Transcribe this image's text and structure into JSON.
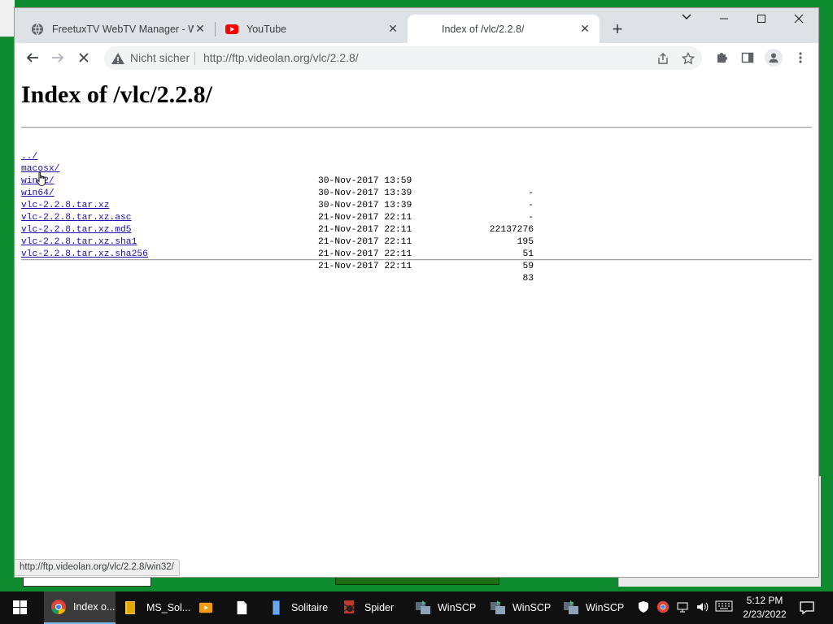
{
  "browser": {
    "tabs": [
      {
        "title": "FreetuxTV WebTV Manager - We",
        "icon": "globe-icon",
        "active": false
      },
      {
        "title": "YouTube",
        "icon": "youtube-icon",
        "active": false
      },
      {
        "title": "Index of /vlc/2.2.8/",
        "icon": "none",
        "active": true
      }
    ],
    "new_tab_label": "+",
    "security_label": "Nicht sicher",
    "url": "http://ftp.videolan.org/vlc/2.2.8/",
    "status_url": "http://ftp.videolan.org/vlc/2.2.8/win32/"
  },
  "page": {
    "heading": "Index of /vlc/2.2.8/",
    "entries": [
      {
        "name": "../",
        "date": "",
        "size": ""
      },
      {
        "name": "macosx/",
        "date": "30-Nov-2017 13:59",
        "size": "-"
      },
      {
        "name": "win32/",
        "date": "30-Nov-2017 13:39",
        "size": "-"
      },
      {
        "name": "win64/",
        "date": "30-Nov-2017 13:39",
        "size": "-"
      },
      {
        "name": "vlc-2.2.8.tar.xz",
        "date": "21-Nov-2017 22:11",
        "size": "22137276"
      },
      {
        "name": "vlc-2.2.8.tar.xz.asc",
        "date": "21-Nov-2017 22:11",
        "size": "195"
      },
      {
        "name": "vlc-2.2.8.tar.xz.md5",
        "date": "21-Nov-2017 22:11",
        "size": "51"
      },
      {
        "name": "vlc-2.2.8.tar.xz.sha1",
        "date": "21-Nov-2017 22:11",
        "size": "59"
      },
      {
        "name": "vlc-2.2.8.tar.xz.sha256",
        "date": "21-Nov-2017 22:11",
        "size": "83"
      }
    ]
  },
  "taskbar": {
    "items": [
      {
        "label": "Index o...",
        "icon": "chrome-icon",
        "active": true
      },
      {
        "label": "MS_Sol...",
        "icon": "folder-icon",
        "active": false
      },
      {
        "label": "",
        "icon": "media-player-icon",
        "active": false
      },
      {
        "label": "",
        "icon": "notepad-icon",
        "active": false
      },
      {
        "label": "Solitaire",
        "icon": "solitaire-icon",
        "active": false
      },
      {
        "label": "Spider",
        "icon": "spider-icon",
        "active": false
      },
      {
        "label": "WinSCP",
        "icon": "winscp-icon",
        "active": false
      },
      {
        "label": "WinSCP",
        "icon": "winscp-icon",
        "active": false
      },
      {
        "label": "WinSCP",
        "icon": "winscp-icon",
        "active": false
      }
    ],
    "time": "5:12 PM",
    "date": "2/23/2022"
  },
  "colors": {
    "desktop": "#0e8b2f",
    "link": "#1a0dab",
    "taskbar": "#101010",
    "tabstrip": "#dee1e6"
  }
}
